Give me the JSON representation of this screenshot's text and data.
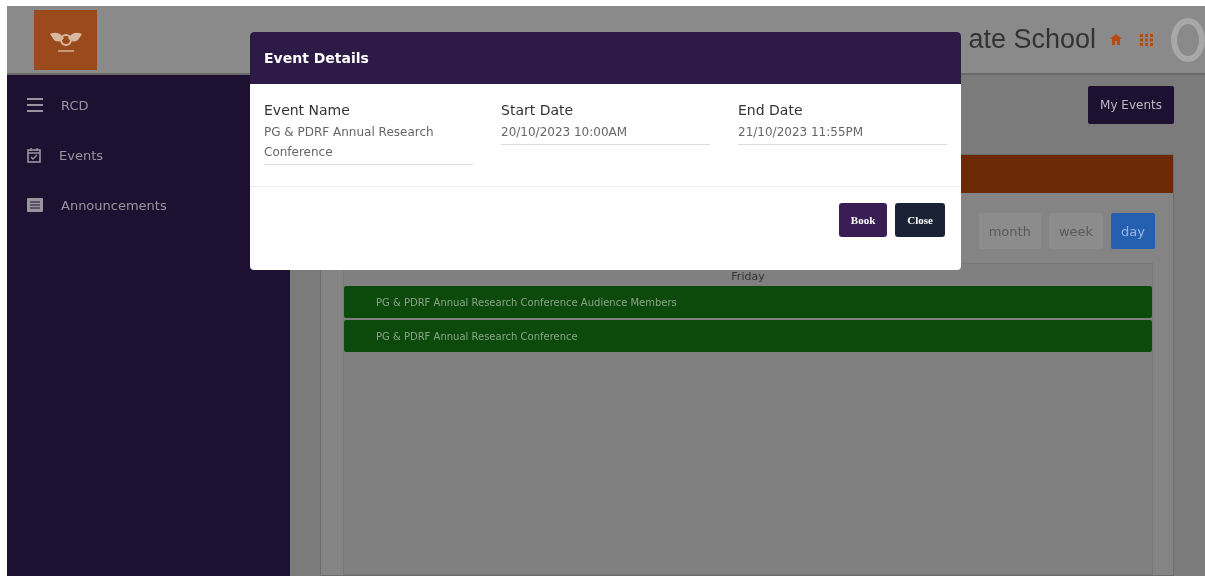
{
  "header": {
    "title": "ate School"
  },
  "sidebar": {
    "items": [
      {
        "label": "RCD"
      },
      {
        "label": "Events"
      },
      {
        "label": "Announcements"
      }
    ]
  },
  "content": {
    "my_events_button": "My Events",
    "calendar": {
      "view_buttons": [
        {
          "label": "month",
          "selected": false
        },
        {
          "label": "week",
          "selected": false
        },
        {
          "label": "day",
          "selected": true
        }
      ],
      "day_header": "Friday",
      "events": [
        {
          "title": "PG & PDRF Annual Research Conference Audience Members"
        },
        {
          "title": "PG & PDRF Annual Research Conference"
        }
      ]
    }
  },
  "modal": {
    "title": "Event Details",
    "fields": [
      {
        "label": "Event Name",
        "value": "PG & PDRF Annual Research Conference"
      },
      {
        "label": "Start Date",
        "value": "20/10/2023 10:00AM"
      },
      {
        "label": "End Date",
        "value": "21/10/2023 11:55PM"
      }
    ],
    "buttons": [
      {
        "label": "Book",
        "kind": "primary"
      },
      {
        "label": "Close",
        "kind": "secondary"
      }
    ]
  }
}
